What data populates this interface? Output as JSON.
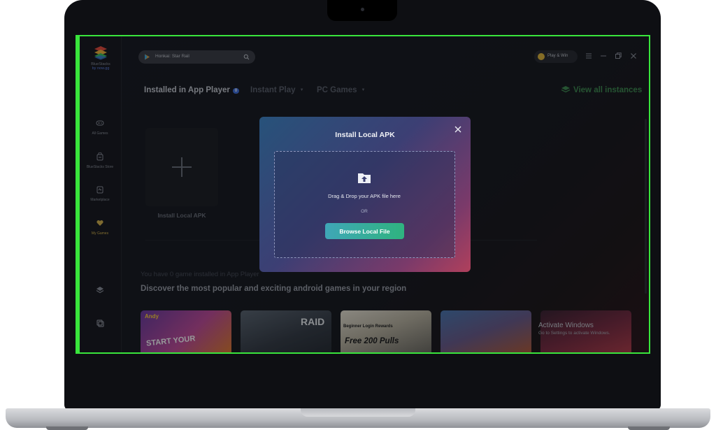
{
  "brand": {
    "name": "BlueStacks",
    "sub": "by now.gg"
  },
  "nav": [
    {
      "label": "All Games",
      "icon": "gamepad-icon"
    },
    {
      "label": "BlueStacks Store",
      "icon": "store-icon"
    },
    {
      "label": "Marketplace",
      "icon": "marketplace-icon"
    },
    {
      "label": "My Games",
      "icon": "heart-icon",
      "active": true
    }
  ],
  "search": {
    "value": "Honkai: Star Rail"
  },
  "playwin": {
    "label": "Play & Win"
  },
  "tabs": [
    {
      "label": "Installed in App Player",
      "badge": "0",
      "active": true
    },
    {
      "label": "Instant Play"
    },
    {
      "label": "PC Games"
    }
  ],
  "view_all": "View all instances",
  "install_tile": {
    "label": "Install Local APK"
  },
  "empty_state": "You have 0 game installed in App Player",
  "discover_title": "Discover the most popular and exciting android games in your region",
  "cards": [
    {
      "text": "START YOUR",
      "brand": "Andy"
    },
    {
      "text": "RAID"
    },
    {
      "text": "Free 200 Pulls",
      "sub": "Beginner Login Rewards"
    },
    {
      "text": ""
    },
    {
      "text": ""
    }
  ],
  "watermark": {
    "title": "Activate Windows",
    "sub": "Go to Settings to activate Windows."
  },
  "modal": {
    "title": "Install Local APK",
    "drop_text": "Drag & Drop your APK file here",
    "or_text": "OR",
    "browse_label": "Browse Local File"
  },
  "colors": {
    "accent_green": "#39e53c",
    "button_start": "#3fa7b7",
    "button_end": "#2fb37f",
    "badge": "#3d6fe0",
    "active_nav": "#d6b24a"
  }
}
